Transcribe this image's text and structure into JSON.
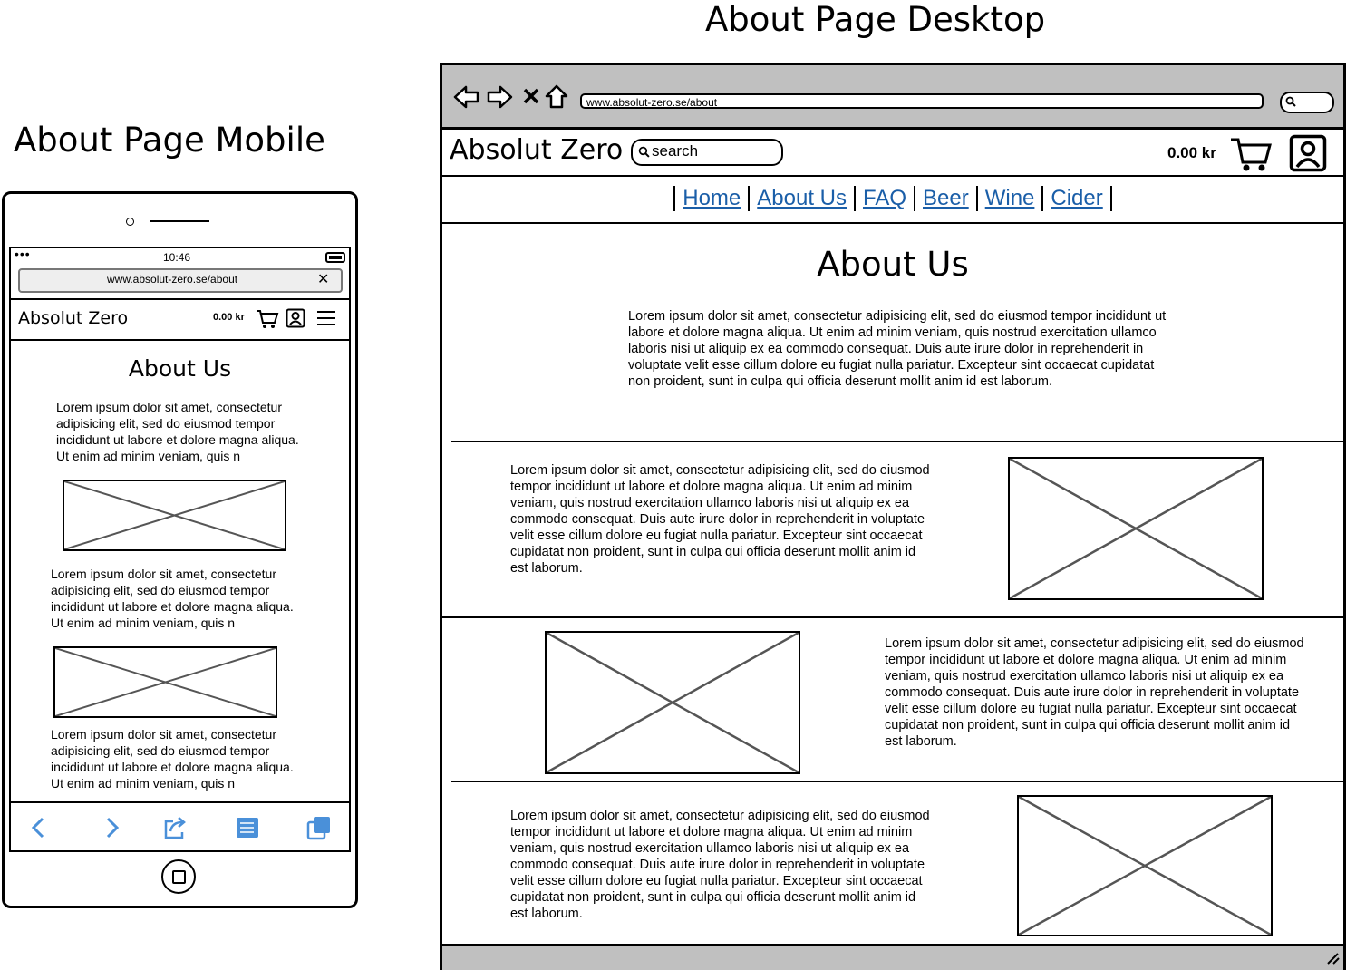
{
  "titles": {
    "mobile": "About Page Mobile",
    "desktop": "About Page Desktop"
  },
  "mobile": {
    "status_time": "10:46",
    "url": "www.absolut-zero.se/about",
    "brand": "Absolut Zero",
    "cart_total": "0.00 kr",
    "heading": "About Us",
    "paragraphs": [
      "Lorem ipsum dolor sit amet, consectetur adipisicing elit, sed do eiusmod tempor incididunt ut labore et dolore magna aliqua. Ut enim ad minim veniam, quis n",
      "Lorem ipsum dolor sit amet, consectetur adipisicing elit, sed do eiusmod tempor incididunt ut labore et dolore magna aliqua. Ut enim ad minim veniam, quis n",
      "Lorem ipsum dolor sit amet, consectetur adipisicing elit, sed do eiusmod tempor incididunt ut labore et dolore magna aliqua. Ut enim ad minim veniam, quis n"
    ],
    "toolbar_icons": [
      "back-icon",
      "forward-icon",
      "share-icon",
      "bookmarks-icon",
      "tabs-icon"
    ],
    "accent_color": "#4a90d9"
  },
  "desktop": {
    "url": "www.absolut-zero.se/about",
    "brand": "Absolut Zero",
    "search_placeholder": "search",
    "cart_total": "0.00 kr",
    "nav": [
      "Home",
      "About Us",
      "FAQ",
      "Beer",
      "Wine",
      "Cider"
    ],
    "link_color": "#1a5ea8",
    "heading": "About Us",
    "intro": "Lorem ipsum dolor sit amet, consectetur adipisicing elit, sed do eiusmod tempor incididunt ut labore et dolore magna aliqua. Ut enim ad minim veniam, quis nostrud exercitation ullamco laboris nisi ut aliquip ex ea commodo consequat. Duis aute irure dolor in reprehenderit in voluptate velit esse cillum dolore eu fugiat nulla pariatur. Excepteur sint occaecat cupidatat non proident, sunt in culpa qui officia deserunt mollit anim id est laborum.",
    "sections": [
      "Lorem ipsum dolor sit amet, consectetur adipisicing elit, sed do eiusmod tempor incididunt ut labore et dolore magna aliqua. Ut enim ad minim veniam, quis nostrud exercitation ullamco laboris nisi ut aliquip ex ea commodo consequat. Duis aute irure dolor in reprehenderit in voluptate velit esse cillum dolore eu fugiat nulla pariatur. Excepteur sint occaecat cupidatat non proident, sunt in culpa qui officia deserunt mollit anim id est laborum.",
      "Lorem ipsum dolor sit amet, consectetur adipisicing elit, sed do eiusmod tempor incididunt ut labore et dolore magna aliqua. Ut enim ad minim veniam, quis nostrud exercitation ullamco laboris nisi ut aliquip ex ea commodo consequat. Duis aute irure dolor in reprehenderit in voluptate velit esse cillum dolore eu fugiat nulla pariatur. Excepteur sint occaecat cupidatat non proident, sunt in culpa qui officia deserunt mollit anim id est laborum.",
      "Lorem ipsum dolor sit amet, consectetur adipisicing elit, sed do eiusmod tempor incididunt ut labore et dolore magna aliqua. Ut enim ad minim veniam, quis nostrud exercitation ullamco laboris nisi ut aliquip ex ea commodo consequat. Duis aute irure dolor in reprehenderit in voluptate velit esse cillum dolore eu fugiat nulla pariatur. Excepteur sint occaecat cupidatat non proident, sunt in culpa qui officia deserunt mollit anim id est laborum."
    ]
  }
}
